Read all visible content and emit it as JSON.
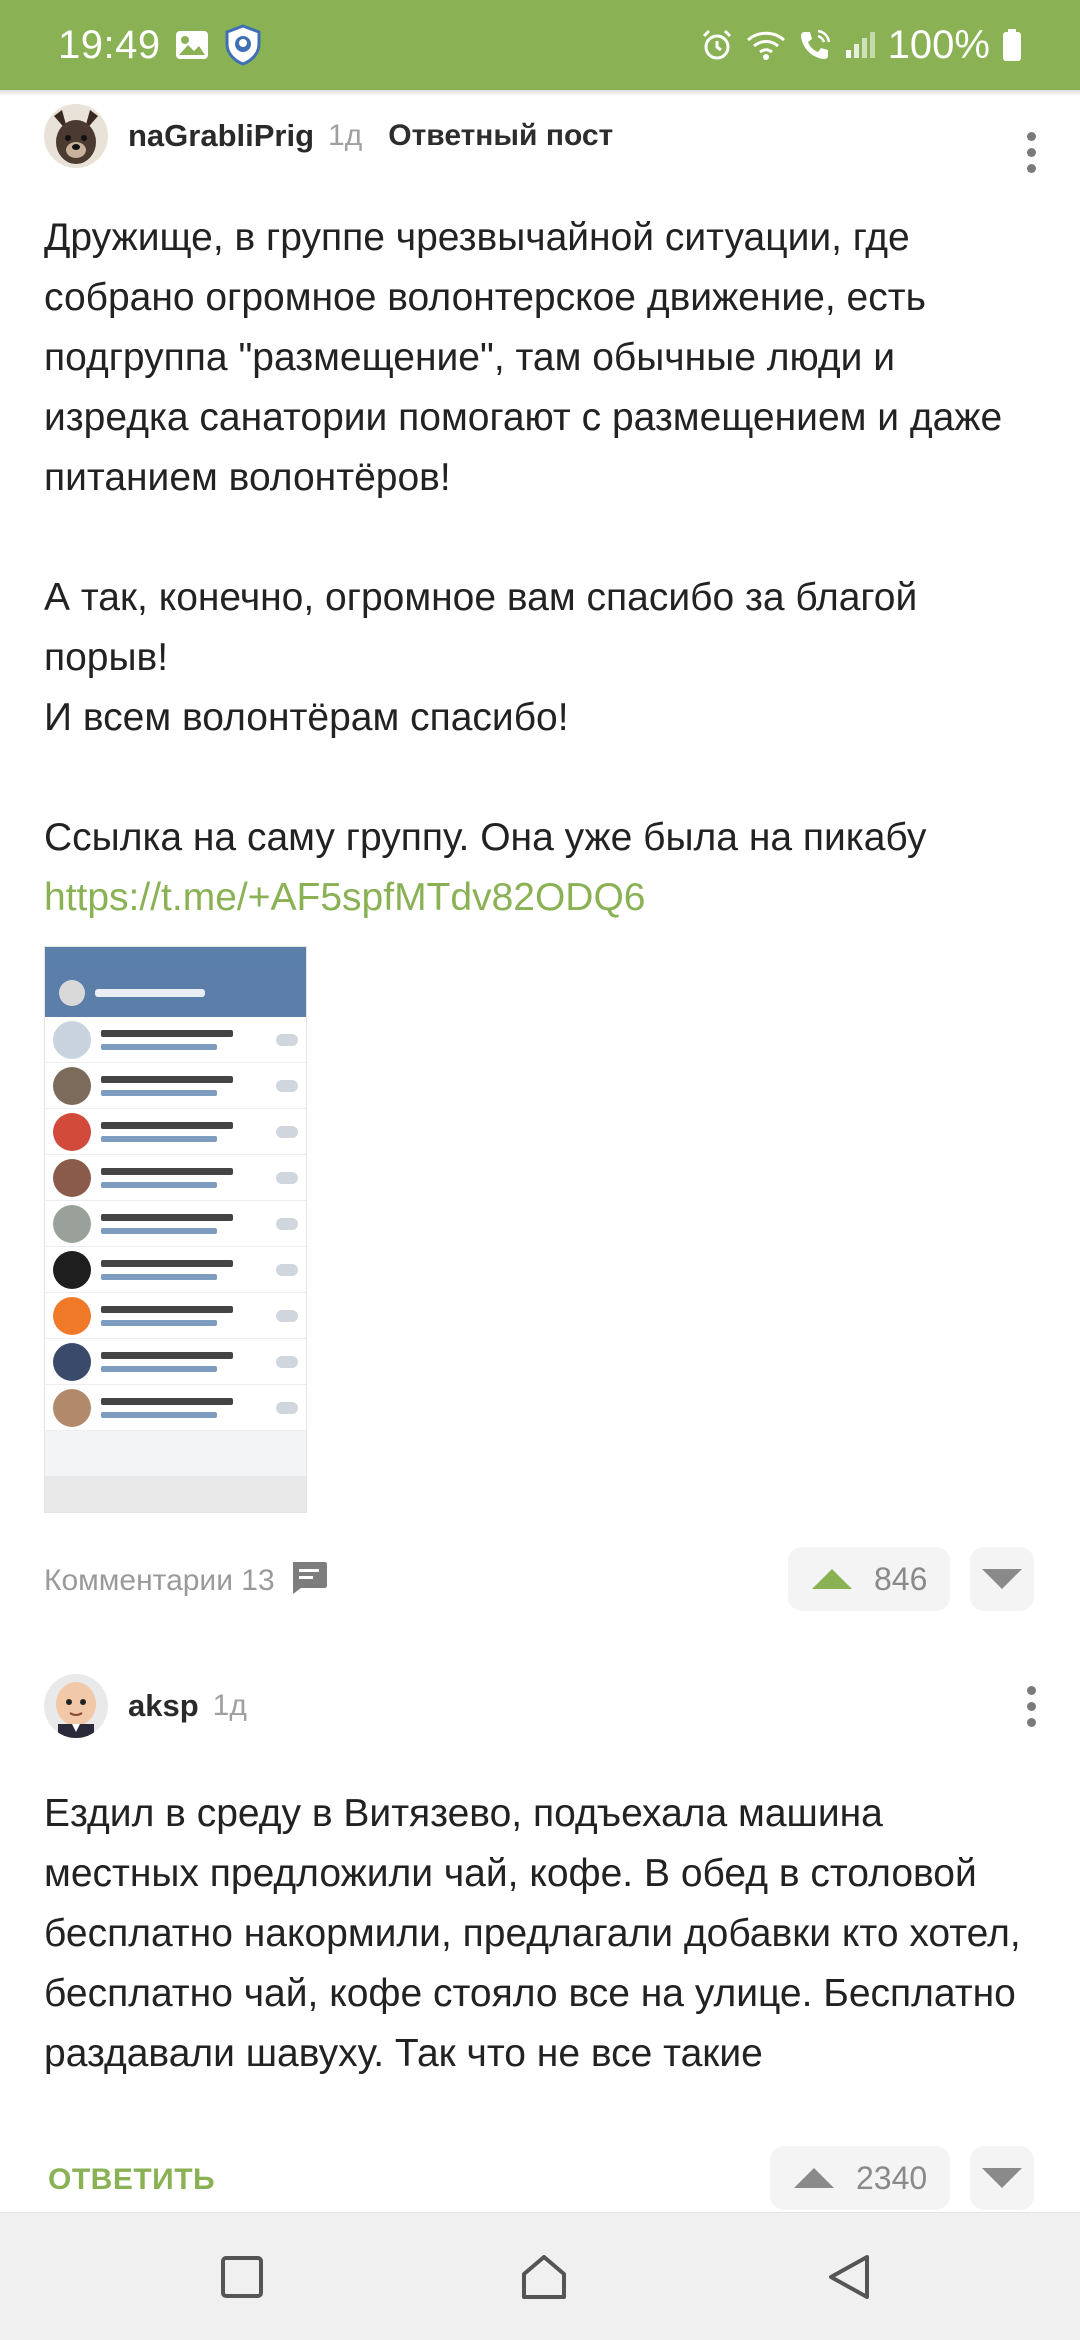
{
  "status_bar": {
    "time": "19:49",
    "battery": "100%",
    "icons_left": [
      "gallery-icon",
      "shield-app-icon"
    ],
    "icons_right": [
      "alarm-icon",
      "wifi-icon",
      "wifi-calling-icon",
      "signal-icon",
      "battery-icon"
    ]
  },
  "post1": {
    "username": "naGrabliPrig",
    "age": "1д",
    "tag": "Ответный пост",
    "paragraphs": [
      "Дружище, в группе чрезвычайной ситуации, где собрано огромное волонтерское движение, есть подгруппа \"размещение\", там обычные люди и изредка санатории помогают с размещением и даже питанием волонтёров!",
      "А так, конечно, огромное вам спасибо за благой порыв!",
      "И всем волонтёрам спасибо!",
      "Ссылка на саму группу. Она уже была на пикабу"
    ],
    "link": "https://t.me/+AF5spfMTdv82ODQ6",
    "comments_label": "Комментарии 13",
    "rating": "846",
    "upvoted": true
  },
  "post2": {
    "username": "aksp",
    "age": "1д",
    "text": "Ездил в среду в Витязево, подъехала машина местных предложили чай, кофе. В обед в столовой бесплатно накормили, предлагали добавки кто хотел, бесплатно чай, кофе стояло все на улице. Бесплатно раздавали шавуху. Так что не все такие",
    "reply_label": "ОТВЕТИТЬ",
    "rating": "2340",
    "upvoted": false
  },
  "colors": {
    "accent": "#8ab255",
    "text": "#222222",
    "muted": "#9a9a9a"
  }
}
